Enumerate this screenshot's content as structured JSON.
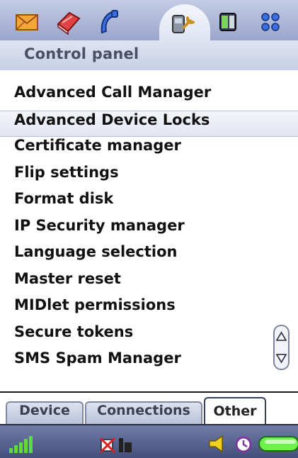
{
  "app_bar": {
    "icons": [
      {
        "name": "messaging-icon",
        "color": "#e08020"
      },
      {
        "name": "contacts-icon",
        "color": "#d83030"
      },
      {
        "name": "phone-icon",
        "color": "#2a5bd0"
      },
      {
        "name": "control-panel-icon",
        "color": "#606878",
        "selected": true
      },
      {
        "name": "multimedia-icon",
        "color": "#3a8a30"
      },
      {
        "name": "applications-icon",
        "color": "#3060c0"
      }
    ]
  },
  "title": "Control panel",
  "list": {
    "items": [
      {
        "label": "Advanced Call Manager"
      },
      {
        "label": "Advanced Device Locks",
        "selected": true
      },
      {
        "label": "Certificate manager"
      },
      {
        "label": "Flip settings"
      },
      {
        "label": "Format disk"
      },
      {
        "label": "IP Security manager"
      },
      {
        "label": "Language selection"
      },
      {
        "label": "Master reset"
      },
      {
        "label": "MIDlet permissions"
      },
      {
        "label": "Secure tokens"
      },
      {
        "label": "SMS Spam Manager"
      }
    ]
  },
  "tabs": [
    {
      "label": "Device"
    },
    {
      "label": "Connections"
    },
    {
      "label": "Other",
      "active": true
    }
  ],
  "status_bar": {
    "icons": [
      "signal-strength-icon",
      "no-sim-card-icon",
      "volume-icon",
      "alarm-clock-icon",
      "battery-icon"
    ],
    "accent": "#44507c"
  }
}
